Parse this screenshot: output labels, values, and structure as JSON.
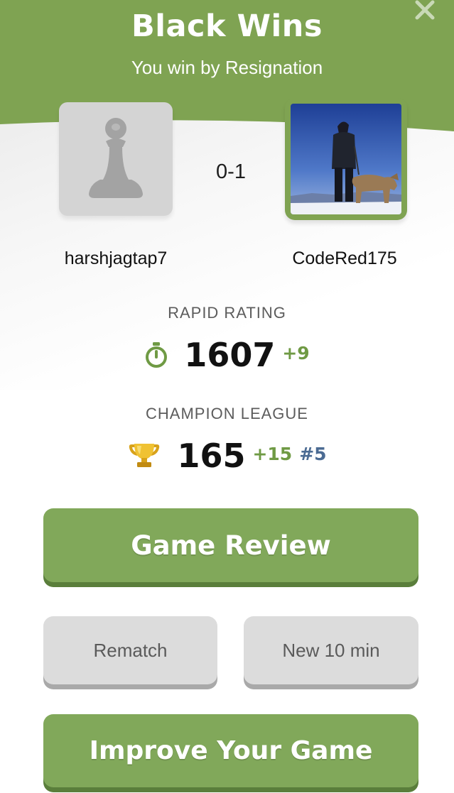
{
  "header": {
    "title": "Black Wins",
    "subtitle": "You win by Resignation",
    "close_icon": "close-icon"
  },
  "colors": {
    "accent_green": "#7fa352",
    "delta_green": "#6f9a44",
    "rank_blue": "#4b6b93",
    "button_gray": "#dcdcdc"
  },
  "players": {
    "white": {
      "name": "harshjagtap7",
      "avatar": "pawn-icon"
    },
    "black": {
      "name": "CodeRed175",
      "avatar": "profile-photo"
    }
  },
  "result": {
    "score": "0-1"
  },
  "rating": {
    "label": "RAPID RATING",
    "icon": "stopwatch-icon",
    "value": "1607",
    "delta": "+9"
  },
  "league": {
    "label": "CHAMPION LEAGUE",
    "icon": "trophy-icon",
    "value": "165",
    "delta": "+15",
    "rank": "#5"
  },
  "buttons": {
    "game_review": "Game Review",
    "rematch": "Rematch",
    "new_game": "New 10 min",
    "improve": "Improve Your Game"
  }
}
